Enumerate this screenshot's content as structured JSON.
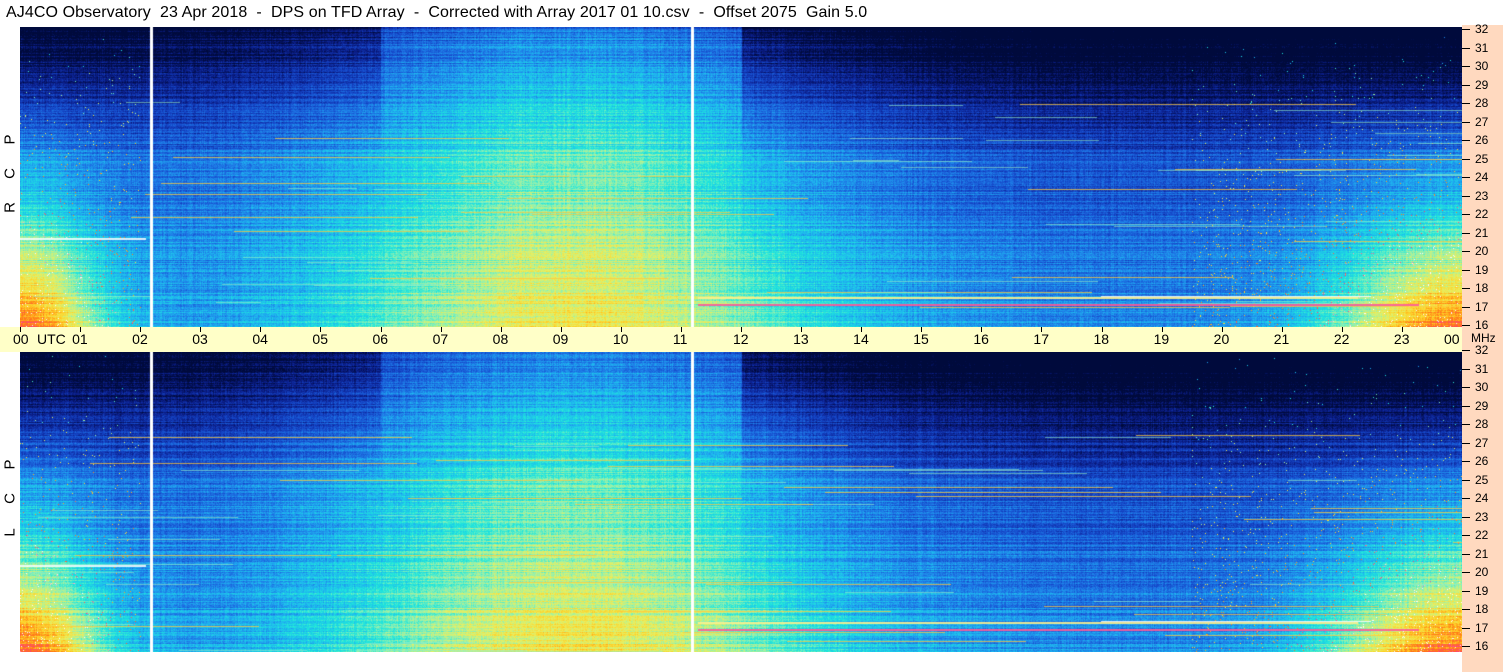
{
  "header": {
    "title": "AJ4CO Observatory  23 Apr 2018  -  DPS on TFD Array  -  Corrected with Array 2017 01 10.csv  -  Offset 2075  Gain 5.0"
  },
  "panels": {
    "rcp_label": [
      "R",
      "C",
      "P"
    ],
    "lcp_label": [
      "L",
      "C",
      "P"
    ]
  },
  "chart_data": {
    "type": "heatmap",
    "title": "AJ4CO Observatory  23 Apr 2018  -  DPS on TFD Array  -  Corrected with Array 2017 01 10.csv  -  Offset 2075  Gain 5.0",
    "series": [
      {
        "name": "R C P",
        "quantity": "spectral power"
      },
      {
        "name": "L C P",
        "quantity": "spectral power"
      }
    ],
    "x_axis": {
      "unit": "UTC",
      "ticks": [
        "00",
        "01",
        "02",
        "03",
        "04",
        "05",
        "06",
        "07",
        "08",
        "09",
        "10",
        "11",
        "12",
        "13",
        "14",
        "15",
        "16",
        "17",
        "18",
        "19",
        "20",
        "21",
        "22",
        "23",
        "00"
      ],
      "range_hours": [
        0,
        24
      ]
    },
    "y_axis": {
      "unit": "MHz",
      "ticks": [
        16,
        17,
        18,
        19,
        20,
        21,
        22,
        23,
        24,
        25,
        26,
        27,
        28,
        29,
        30,
        31,
        32
      ],
      "range": [
        16,
        32
      ]
    },
    "markers_utc_hours": [
      2.17,
      11.17
    ],
    "colormap": [
      "#000a3c",
      "#0b1e8a",
      "#1546c8",
      "#1e78e6",
      "#1eb4f0",
      "#1ee6dc",
      "#8cf0b4",
      "#e6f064",
      "#ffd228",
      "#ff7814",
      "#ff3c82",
      "#ffffff"
    ]
  }
}
